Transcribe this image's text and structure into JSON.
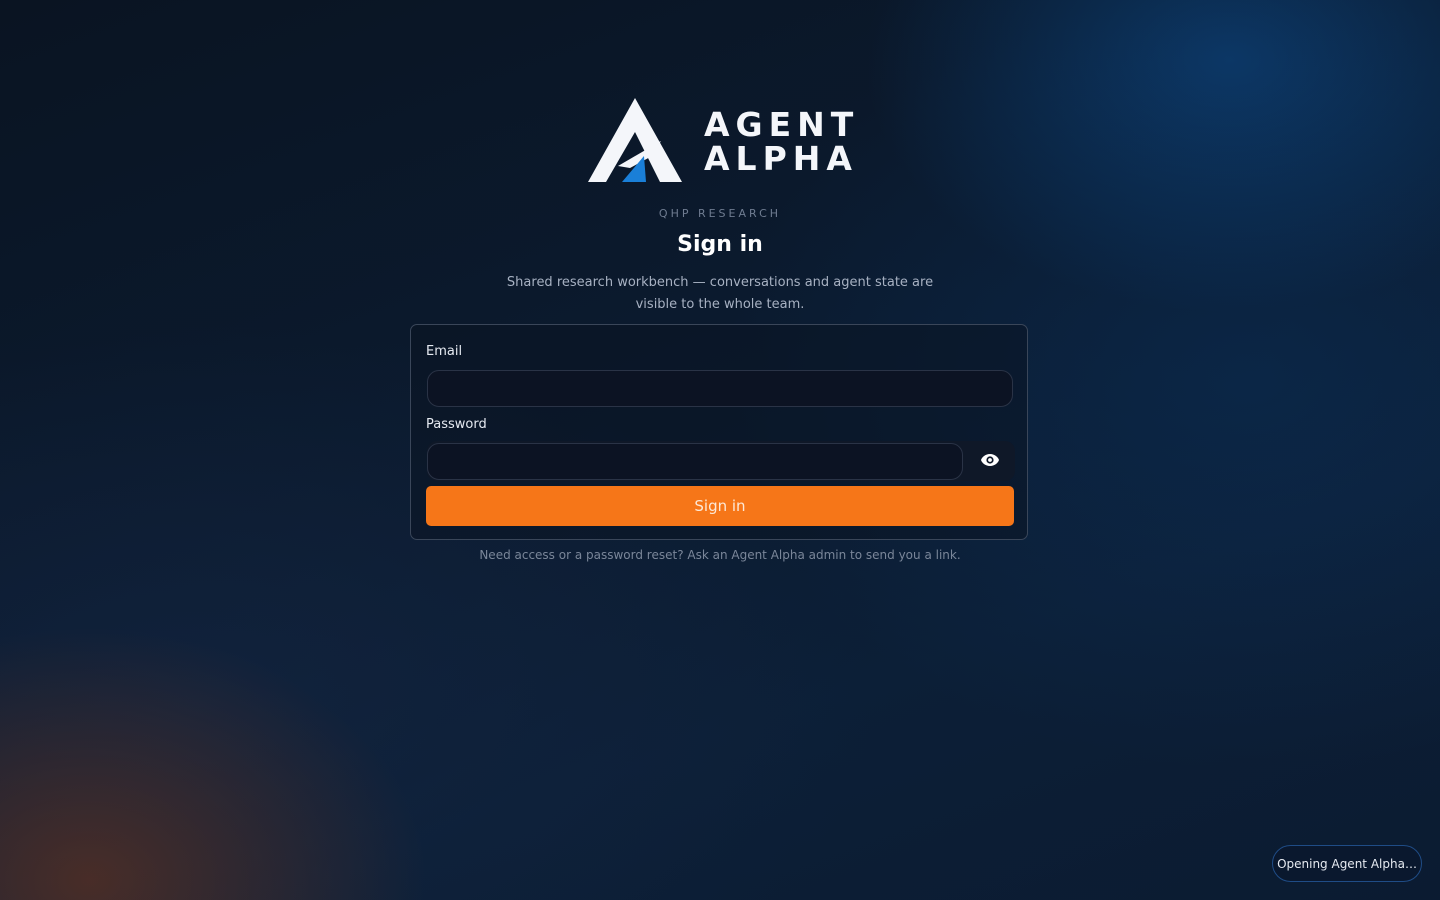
{
  "brand": {
    "logo_lines": [
      "AGENT",
      "ALPHA"
    ],
    "org_label": "QHP RESEARCH",
    "colors": {
      "logo_white": "#f4f6fa",
      "logo_accent": "#1a7fd8",
      "primary_button": "#f67618"
    }
  },
  "heading": {
    "title": "Sign in",
    "subtitle": "Shared research workbench — conversations and agent state are visible to the whole team."
  },
  "form": {
    "email_label": "Email",
    "email_value": "",
    "password_label": "Password",
    "password_value": "",
    "password_toggle_icon": "eye-icon",
    "submit_label": "Sign in"
  },
  "help_text": "Need access or a password reset? Ask an Agent Alpha admin to send you a link.",
  "toast": {
    "message": "Opening Agent Alpha…"
  }
}
